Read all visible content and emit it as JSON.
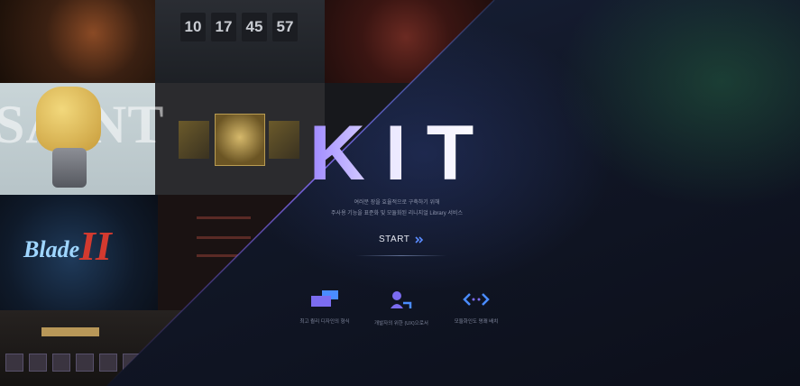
{
  "countdown": {
    "d1": "10",
    "d2": "17",
    "d3": "45",
    "d4": "57"
  },
  "collage": {
    "saint_text": "SAINT",
    "bns_logo": "Blade",
    "bns_numeral": "II"
  },
  "hero": {
    "logo": "KIT",
    "tagline_line1": "여러분 장을 효율적으로 구축하기 위해",
    "tagline_line2": "주사용 기능을 표준화 및 모듈화된 리니지얼 Library 서비스"
  },
  "start": {
    "label": "START",
    "icon": "double-chevron-right-icon"
  },
  "features": [
    {
      "icon": "stacked-blocks-icon",
      "label": "최고 퀄리 디자인의 형식"
    },
    {
      "icon": "user-arrow-icon",
      "label": "개발자의 위한 (UX)으로서"
    },
    {
      "icon": "code-arrows-icon",
      "label": "모듈화인도 명쾌 배치"
    }
  ],
  "colors": {
    "accent": "#4a7cf0",
    "logo_start": "#a08cff",
    "logo_end": "#ffffff",
    "panel_bg": "#111727"
  }
}
